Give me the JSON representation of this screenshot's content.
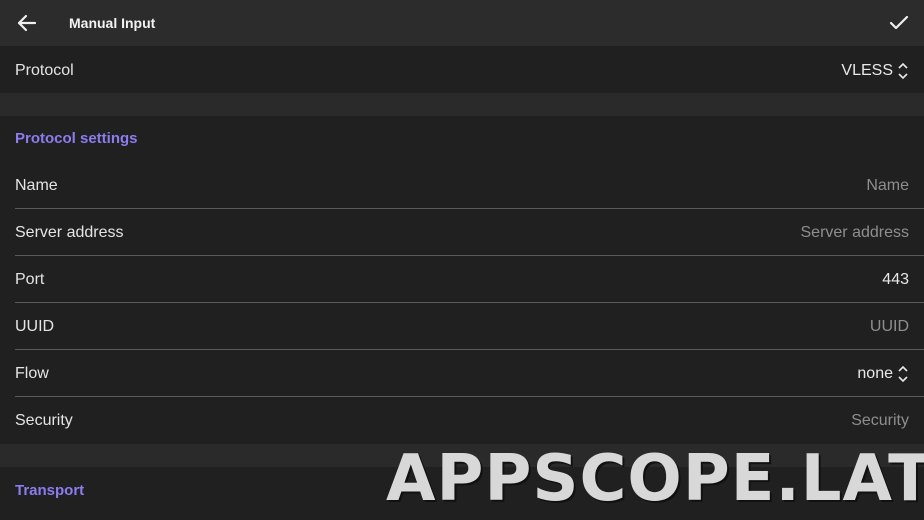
{
  "header": {
    "title": "Manual Input",
    "back_icon": "arrow-left-icon",
    "save_icon": "check-icon"
  },
  "protocol": {
    "label": "Protocol",
    "value": "VLESS"
  },
  "protocol_settings": {
    "title": "Protocol settings",
    "fields": [
      {
        "label": "Name",
        "value": "",
        "placeholder": "Name"
      },
      {
        "label": "Server address",
        "value": "",
        "placeholder": "Server address"
      },
      {
        "label": "Port",
        "value": "443",
        "placeholder": ""
      },
      {
        "label": "UUID",
        "value": "",
        "placeholder": "UUID"
      },
      {
        "label": "Flow",
        "value": "none",
        "placeholder": ""
      },
      {
        "label": "Security",
        "value": "",
        "placeholder": "Security"
      }
    ]
  },
  "transport": {
    "title": "Transport"
  },
  "watermark": "APPSCOPE.LAT",
  "colors": {
    "accent": "#8c7cf0",
    "background": "#202020",
    "topbar": "#2c2c2c"
  }
}
